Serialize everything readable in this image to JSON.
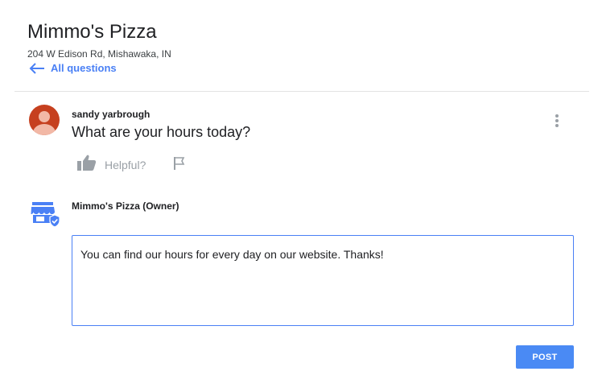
{
  "place": {
    "name": "Mimmo's Pizza",
    "address": "204 W Edison Rd, Mishawaka, IN"
  },
  "nav": {
    "back_label": "All questions",
    "back_icon": "arrow-left-icon"
  },
  "question": {
    "author": "sandy yarbrough",
    "text": "What are your hours today?",
    "helpful_label": "Helpful?",
    "avatar_color": "#c6401f"
  },
  "reply": {
    "owner_label": "Mimmo's Pizza (Owner)",
    "text": "You can find our hours for every day on our website. Thanks!",
    "post_label": "POST"
  },
  "colors": {
    "accent": "#4a80f5",
    "muted": "#9aa0a6"
  }
}
